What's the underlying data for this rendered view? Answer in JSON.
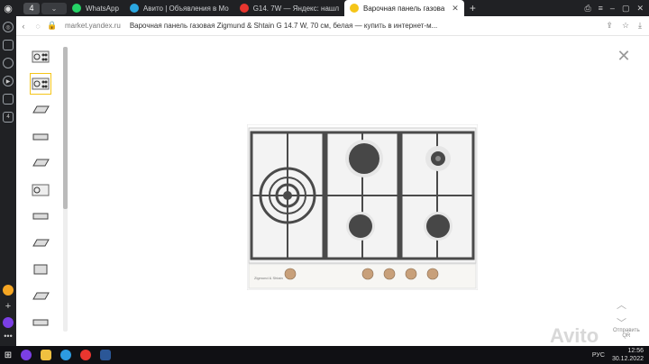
{
  "tabbar": {
    "tab_count": "4",
    "tabs": [
      {
        "label": "WhatsApp",
        "color": "#25d366"
      },
      {
        "label": "Авито | Объявления в Мо",
        "color": "#2ba7e1"
      },
      {
        "label": "G14. 7W — Яндекс: нашл",
        "color": "#e8362f"
      },
      {
        "label": "Варочная панель газова",
        "color": "#f5c518"
      }
    ]
  },
  "address": {
    "url": "market.yandex.ru",
    "title": "Варочная панель газовая Zigmund & Shtain G 14.7 W, 70 см, белая — купить в интернет-м..."
  },
  "product": {
    "brand_label": "Zigmund & Shtain",
    "colors": {
      "frame": "#dcdcdc",
      "grate": "#4a4a4a",
      "panel": "#f4f3f0",
      "knob": "#c8a07a"
    }
  },
  "viewer": {
    "send_label": "Отправить",
    "send_label2": "QR"
  },
  "taskbar": {
    "lang": "РУС",
    "time": "12:56",
    "date": "30.12.2022"
  },
  "watermark": "Avito"
}
